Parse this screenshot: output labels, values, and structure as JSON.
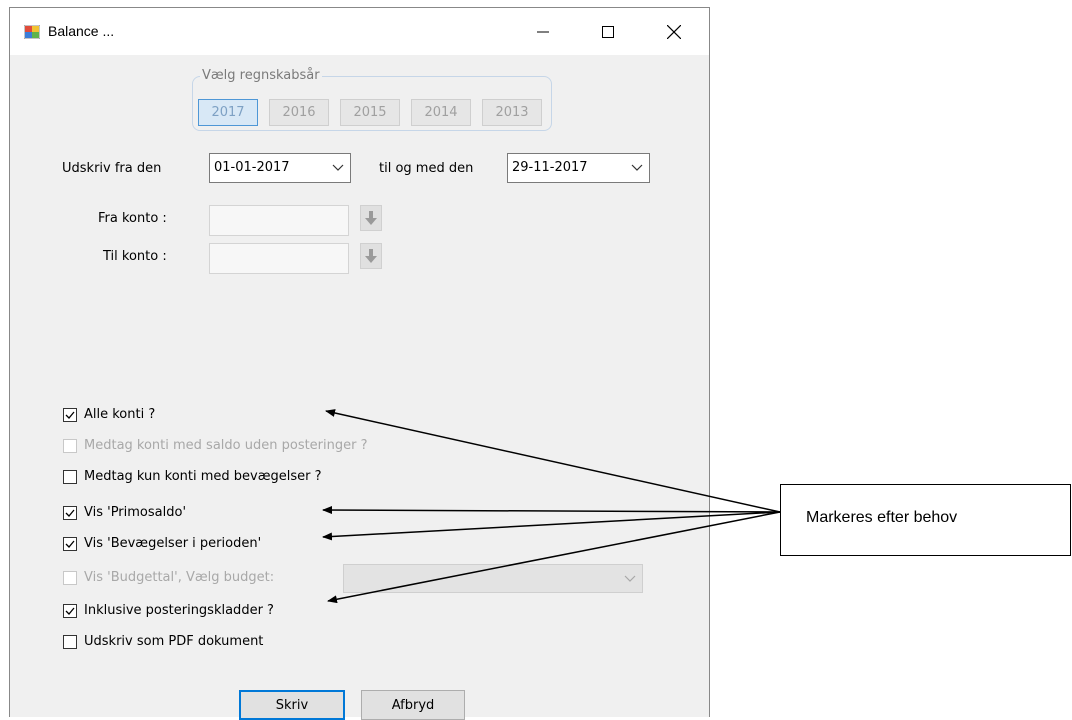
{
  "window": {
    "title": "Balance ...",
    "icons": {
      "app": "app-window-icon",
      "minimize": "minimize-icon",
      "maximize": "maximize-icon",
      "close": "close-icon"
    }
  },
  "fiscal_year": {
    "legend": "Vælg regnskabsår",
    "years": [
      "2017",
      "2016",
      "2015",
      "2014",
      "2013"
    ],
    "selected": "2017"
  },
  "date_range": {
    "from_label": "Udskriv fra den",
    "from_value": "01-01-2017",
    "to_label": "til og med den",
    "to_value": "29-11-2017"
  },
  "accounts": {
    "from_label": "Fra konto :",
    "from_value": "",
    "to_label": "Til konto :",
    "to_value": "",
    "lookup_icon": "arrow-down-icon"
  },
  "options": [
    {
      "label": "Alle konti ?",
      "checked": true,
      "enabled": true
    },
    {
      "label": "Medtag konti med saldo uden posteringer ?",
      "checked": false,
      "enabled": false
    },
    {
      "label": "Medtag kun konti med bevægelser ?",
      "checked": false,
      "enabled": true
    },
    {
      "label": "Vis 'Primosaldo'",
      "checked": true,
      "enabled": true
    },
    {
      "label": "Vis 'Bevægelser i perioden'",
      "checked": true,
      "enabled": true
    },
    {
      "label": "Vis 'Budgettal', Vælg budget:",
      "checked": false,
      "enabled": false
    },
    {
      "label": "Inklusive posteringskladder ?",
      "checked": true,
      "enabled": true
    },
    {
      "label": "Udskriv som PDF dokument",
      "checked": false,
      "enabled": true
    }
  ],
  "budget_select": {
    "value": ""
  },
  "buttons": {
    "print": "Skriv",
    "cancel": "Afbryd"
  },
  "annotation": {
    "text": "Markeres efter behov"
  },
  "colors": {
    "accent": "#0078d7",
    "window_bg": "#f0f0f0",
    "selected_year_bg": "#d8e8f6"
  }
}
